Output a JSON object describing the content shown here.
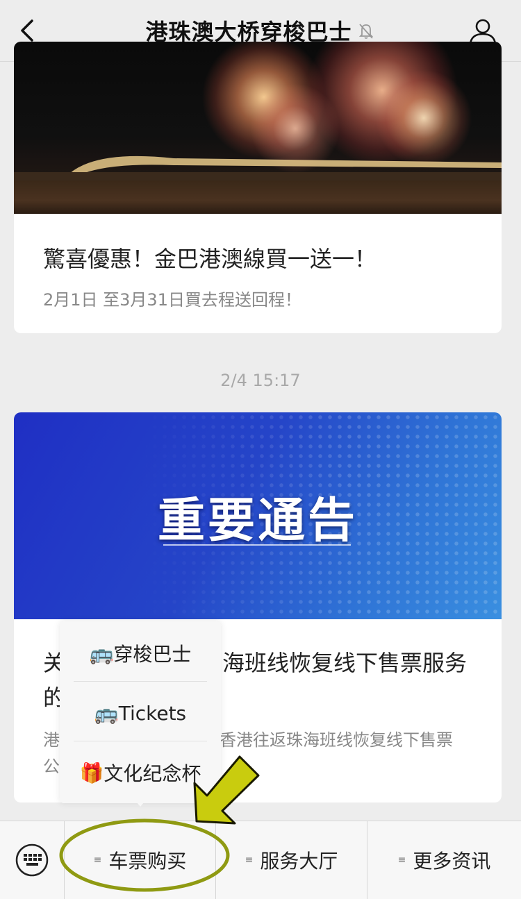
{
  "header": {
    "title": "港珠澳大桥穿梭巴士",
    "back_icon": "chevron-left-icon",
    "mute_icon": "bell-off-icon",
    "profile_icon": "user-icon"
  },
  "articles": [
    {
      "title": "驚喜優惠！金巴港澳線買一送一！",
      "desc": "2月1日 至3月31日買去程送回程！"
    },
    {
      "timestamp": "2/4 15:17",
      "banner_text": "重要通告",
      "title_line1_start": "关",
      "title_line1_end": "海班线恢复线下售票服务",
      "title_line2_start": "的",
      "desc_line1_start": "港",
      "desc_line1_end": "香港往返珠海班线恢复线下售票",
      "desc_line2_start": "公"
    }
  ],
  "submenu": {
    "items": [
      {
        "icon": "🚌",
        "label": "穿梭巴士"
      },
      {
        "icon": "🚌",
        "label": "Tickets"
      },
      {
        "icon": "🎁",
        "label": "文化纪念杯"
      }
    ]
  },
  "footer": {
    "keyboard_icon": "keyboard-icon",
    "menus": [
      "车票购买",
      "服务大厅",
      "更多资讯"
    ]
  },
  "colors": {
    "banner_blue": "#2545c8",
    "annotation_olive": "#8f9a12",
    "arrow_fill": "#c9cc0e"
  }
}
